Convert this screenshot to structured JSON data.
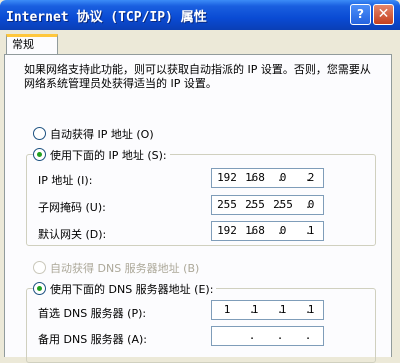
{
  "window": {
    "title": "Internet 协议 (TCP/IP) 属性",
    "help_label": "?",
    "close_label": "✕"
  },
  "tab": {
    "label": "常规"
  },
  "description": "如果网络支持此功能，则可以获取自动指派的 IP 设置。否则，您需要从网络系统管理员处获得适当的 IP 设置。",
  "ip_section": {
    "auto_label": "自动获得 IP 地址 (O)",
    "manual_label": "使用下面的 IP 地址 (S):",
    "fields": [
      {
        "label": "IP 地址 (I):",
        "octets": [
          "192",
          "168",
          "0",
          "2"
        ]
      },
      {
        "label": "子网掩码 (U):",
        "octets": [
          "255",
          "255",
          "255",
          "0"
        ]
      },
      {
        "label": "默认网关 (D):",
        "octets": [
          "192",
          "168",
          "0",
          "1"
        ]
      }
    ]
  },
  "dns_section": {
    "auto_label": "自动获得 DNS 服务器地址 (B)",
    "manual_label": "使用下面的 DNS 服务器地址 (E):",
    "fields": [
      {
        "label": "首选 DNS 服务器 (P):",
        "octets": [
          "1",
          "1",
          "1",
          "1"
        ]
      },
      {
        "label": "备用 DNS 服务器 (A):",
        "octets": [
          "",
          "",
          "",
          ""
        ]
      }
    ]
  }
}
